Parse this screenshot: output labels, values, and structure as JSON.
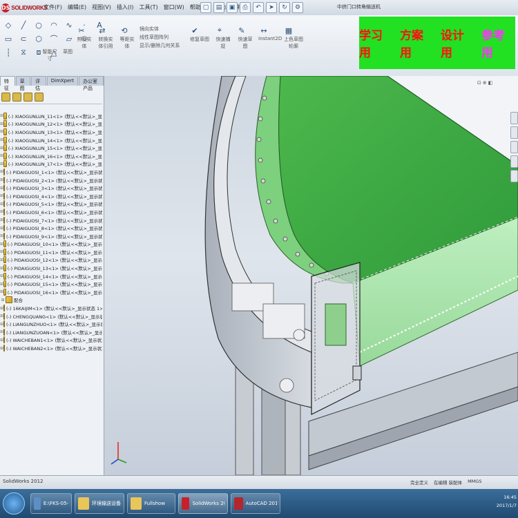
{
  "app": {
    "logo_text": "SOLIDWORKS",
    "window_title": "中挤门口转角输送机",
    "menus": [
      "文件(F)",
      "编辑(E)",
      "视图(V)",
      "插入(I)",
      "工具(T)",
      "窗口(W)",
      "帮助(H)",
      "自动工具箱"
    ]
  },
  "toolbar": {
    "quick_icons": [
      "new-icon",
      "open-icon",
      "save-icon",
      "print-icon",
      "undo-icon",
      "select-icon",
      "rebuild-icon",
      "options-icon"
    ]
  },
  "ribbon": {
    "labels": [
      "智能尺寸",
      "草图",
      "剪裁实体",
      "转换实体引用",
      "等距实体",
      "镜向实体",
      "线性草图阵列",
      "显示/删除几何关系",
      "修复草图",
      "快速捕捉",
      "快速草图",
      "Instant2D",
      "上色草图轮廓"
    ]
  },
  "ad_banner": {
    "items": [
      "学习用",
      "方案用",
      "设计用",
      "参考用"
    ]
  },
  "feature_tree": {
    "tabs": [
      "特征",
      "草图",
      "评估",
      "DimXpert",
      "办公室产品"
    ],
    "items": [
      "(-) XIAOGUNLUN_11<1> (默认<<默认>_显",
      "(-) XIAOGUNLUN_12<1> (默认<<默认>_显",
      "(-) XIAOGUNLUN_13<1> (默认<<默认>_显",
      "(-) XIAOGUNLUN_14<1> (默认<<默认>_显",
      "(-) XIAOGUNLUN_15<1> (默认<<默认>_显",
      "(-) XIAOGUNLUN_16<1> (默认<<默认>_显",
      "(-) XIAOGUNLUN_17<1> (默认<<默认>_显",
      "(-) PIDAIGUOSI_1<1> (默认<<默认>_显示状",
      "(-) PIDAIGUOSI_2<1> (默认<<默认>_显示状",
      "(-) PIDAIGUOSI_3<1> (默认<<默认>_显示状",
      "(-) PIDAIGUOSI_4<1> (默认<<默认>_显示状",
      "(-) PIDAIGUOSI_5<1> (默认<<默认>_显示状",
      "(-) PIDAIGUOSI_6<1> (默认<<默认>_显示状",
      "(-) PIDAIGUOSI_7<1> (默认<<默认>_显示状",
      "(-) PIDAIGUOSI_8<1> (默认<<默认>_显示状",
      "(-) PIDAIGUOSI_9<1> (默认<<默认>_显示状",
      "(-) PIDAIGUOSI_10<1> (默认<<默认>_显示",
      "(-) PIDAIGUOSI_11<1> (默认<<默认>_显示",
      "(-) PIDAIGUOSI_12<1> (默认<<默认>_显示",
      "(-) PIDAIGUOSI_13<1> (默认<<默认>_显示",
      "(-) PIDAIGUOSI_14<1> (默认<<默认>_显示",
      "(-) PIDAIGUOSI_15<1> (默认<<默认>_显示",
      "(-) PIDAIGUOSI_16<1> (默认<<默认>_显示",
      "配合",
      "(-) 16KAIJIM<1> (默认<<默认>_显示状态 1>)",
      "(-) CHENGQUANG<1> (默认<<默认>_显示状态",
      "(-) LIANGUNZHUO<1> (默认<<默认>_显示状态",
      "(-) LIANGUNZUOAN<1> (默认<<默认>_显示状",
      "(-) WAICHEBAN1<1> (默认<<默认>_显示状态",
      "(-) WAICHEBAN2<1> (默认<<默认>_显示状态"
    ]
  },
  "status": {
    "left": "SolidWorks 2012",
    "right": [
      "完全定义",
      "在编辑 装配体",
      "MMGS"
    ]
  },
  "taskbar": {
    "items": [
      {
        "label": "E:\\FKS-05-28.g..."
      },
      {
        "label": "环境输送设备"
      },
      {
        "label": "Fullshow"
      },
      {
        "label": "SolidWorks 2012..."
      },
      {
        "label": "AutoCAD 2012..."
      }
    ],
    "clock": [
      "16:45",
      "2017/1/7"
    ]
  },
  "colors": {
    "ad_bg": "#22e022",
    "ad_text": "#ff1010",
    "belt": "#3fae3f",
    "frame": "#b9bfc8"
  }
}
